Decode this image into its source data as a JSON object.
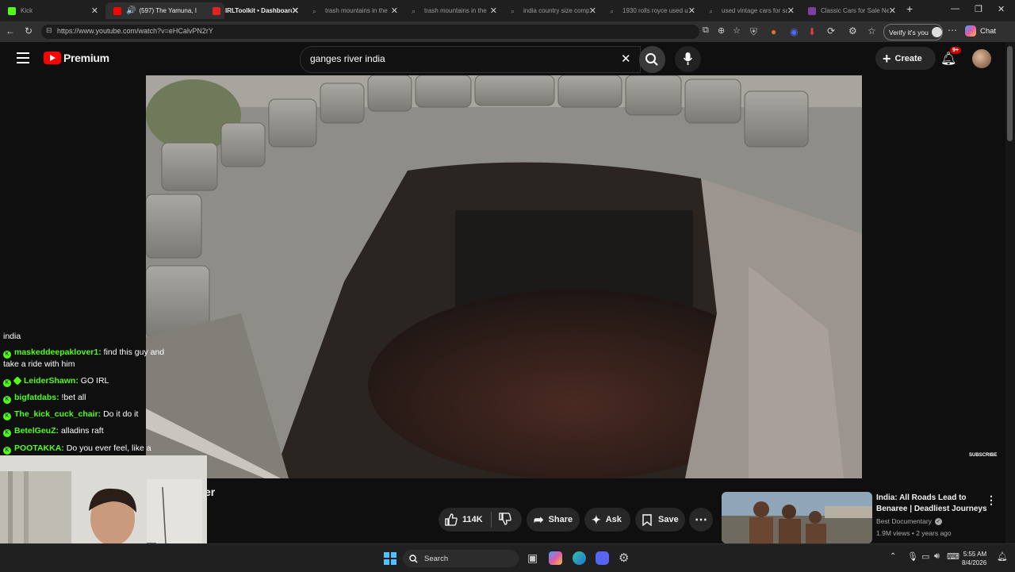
{
  "browser": {
    "tabs": [
      {
        "title": "Kick",
        "favicon_color": "#53fc18",
        "active": false
      },
      {
        "title": "(597) The Yamuna, I",
        "favicon_color": "#ff0000",
        "active": true
      },
      {
        "title": "IRLToolkit • Dashboard",
        "favicon_color": "#e02424",
        "active": false
      },
      {
        "title": "trash mountains in the",
        "favicon_color": "#555555",
        "active": false
      },
      {
        "title": "trash mountains in the",
        "favicon_color": "#555555",
        "active": false
      },
      {
        "title": "india country size comp",
        "favicon_color": "#555555",
        "active": false
      },
      {
        "title": "1930 rolls royce used un",
        "favicon_color": "#555555",
        "active": false
      },
      {
        "title": "used vintage cars for sa",
        "favicon_color": "#555555",
        "active": false
      },
      {
        "title": "Classic Cars for Sale Ne",
        "favicon_color": "#7b3fa0",
        "active": false
      }
    ],
    "url": "https://www.youtube.com/watch?v=eHCalvPN2rY",
    "verify_label": "Verify it's you",
    "chat_label": "Chat"
  },
  "youtube": {
    "logo_text": "Premium",
    "search_value": "ganges river india",
    "create_label": "Create",
    "notification_count": "9+",
    "subscribe_watermark": "SUBSCRIBE",
    "title_fragment": "er",
    "actions": {
      "like_count": "114K",
      "share_label": "Share",
      "ask_label": "Ask",
      "save_label": "Save"
    },
    "recommended": {
      "title": "India: All Roads Lead to Benaree | Deadliest Journeys",
      "channel": "Best Documentary",
      "meta": "1.9M views • 2 years ago"
    }
  },
  "chat": {
    "lines": [
      {
        "user": "",
        "text": "india"
      },
      {
        "user": "maskeddeepaklover1:",
        "text": "find this guy and take a ride with him"
      },
      {
        "user": "LeiderShawn:",
        "text": "GO IRL"
      },
      {
        "user": "bigfatdabs:",
        "text": "!bet all"
      },
      {
        "user": "The_kick_cuck_chair:",
        "text": "Do it do it"
      },
      {
        "user": "BetelGeuZ:",
        "text": "alladins raft"
      },
      {
        "user": "POOTAKKA:",
        "text": "Do you ever feel, like a plastic bag?"
      }
    ]
  },
  "taskbar": {
    "search_label": "Search",
    "time": "5:55 AM",
    "date": "8/4/2026"
  },
  "colors": {
    "youtube_red": "#ff0000",
    "kick_green": "#53fc18",
    "background": "#0f0f0f"
  }
}
